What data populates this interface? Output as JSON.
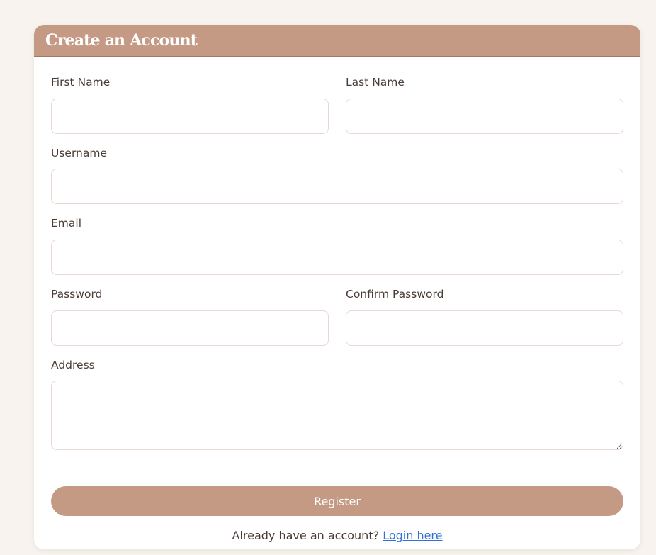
{
  "form": {
    "title": "Create an Account",
    "fields": {
      "first_name": {
        "label": "First Name",
        "value": ""
      },
      "last_name": {
        "label": "Last Name",
        "value": ""
      },
      "username": {
        "label": "Username",
        "value": ""
      },
      "email": {
        "label": "Email",
        "value": ""
      },
      "password": {
        "label": "Password",
        "value": ""
      },
      "confirm_password": {
        "label": "Confirm Password",
        "value": ""
      },
      "address": {
        "label": "Address",
        "value": ""
      }
    },
    "register_label": "Register",
    "login_prompt": "Already have an account?",
    "login_link": "Login here"
  },
  "colors": {
    "accent": "#c49a84",
    "background": "#f8f3ef",
    "text": "#4a3b35",
    "link": "#2f6fd6"
  }
}
